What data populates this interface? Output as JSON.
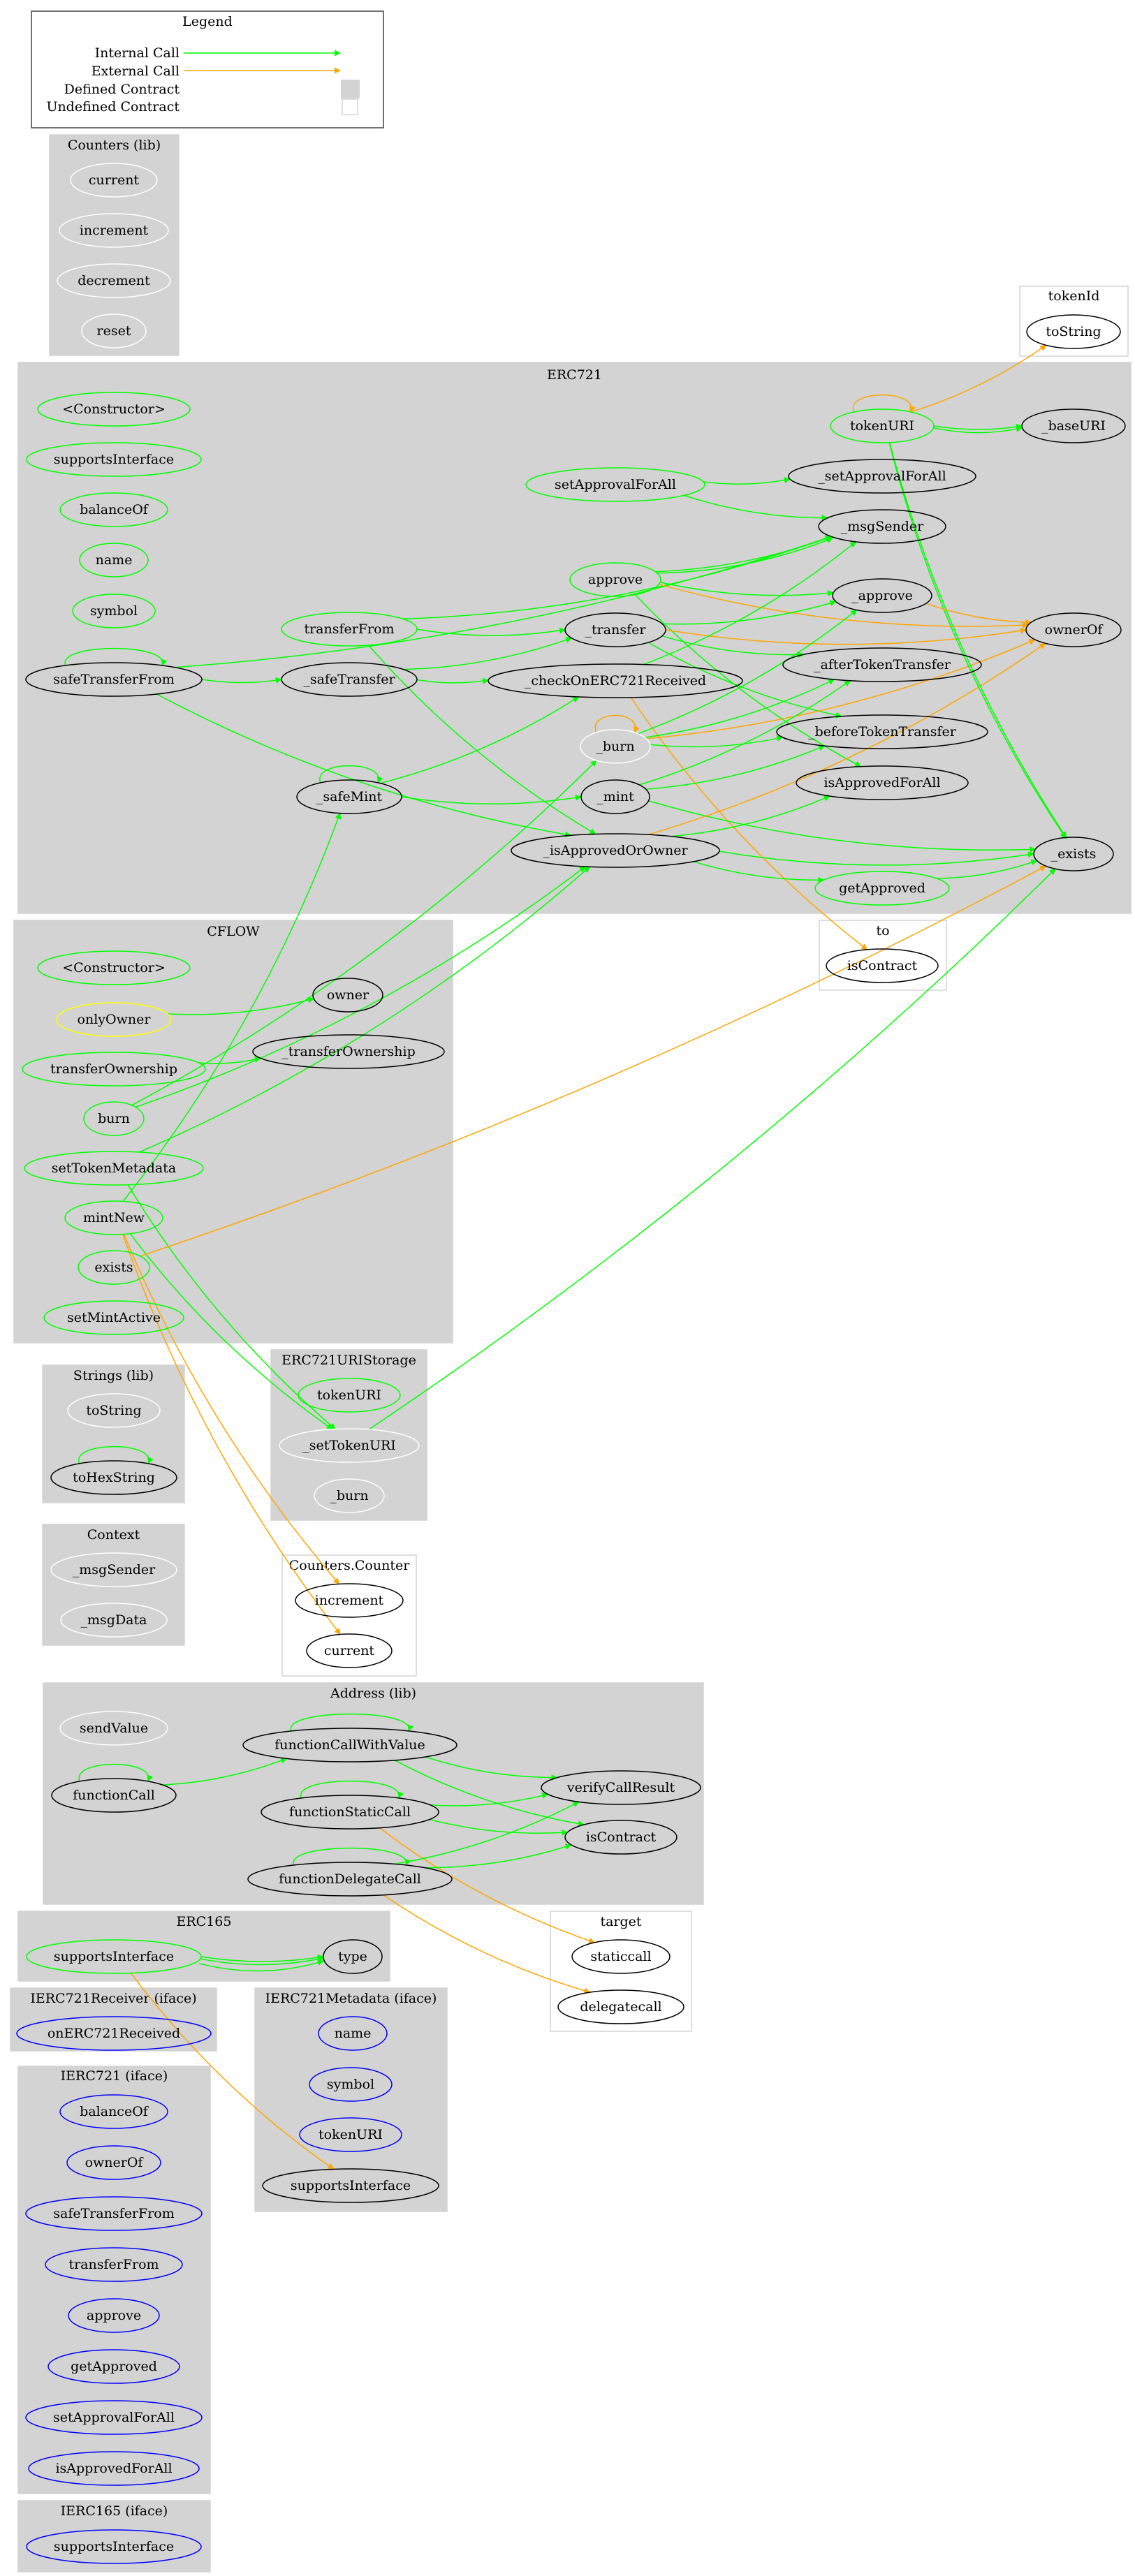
{
  "legend": {
    "title": "Legend",
    "rows": [
      {
        "label": "Internal Call",
        "kind": "internal-arrow"
      },
      {
        "label": "External Call",
        "kind": "external-arrow"
      },
      {
        "label": "Defined Contract",
        "kind": "defined-swatch"
      },
      {
        "label": "Undefined Contract",
        "kind": "undefined-swatch"
      }
    ]
  },
  "colors": {
    "internal_call": "#00ff00",
    "external_call": "#ffa500",
    "defined_cluster_fill": "#d3d3d3",
    "undefined_cluster_border": "#d3d3d3",
    "public_node_border": "#00ff00",
    "modifier_node_border": "#ffff00",
    "interface_node_border": "#0000ff",
    "internal_node_border": "#000000",
    "unused_node_border": "#ffffff"
  },
  "clusters": [
    {
      "id": "counters_lib",
      "title": "Counters  (lib)",
      "defined": true,
      "nodes": [
        {
          "id": "counters_current",
          "label": "current",
          "style": "unused"
        },
        {
          "id": "counters_increment",
          "label": "increment",
          "style": "unused"
        },
        {
          "id": "counters_decrement",
          "label": "decrement",
          "style": "unused"
        },
        {
          "id": "counters_reset",
          "label": "reset",
          "style": "unused"
        }
      ]
    },
    {
      "id": "tokenId",
      "title": "tokenId",
      "defined": false,
      "nodes": [
        {
          "id": "tokenId_toString",
          "label": "toString",
          "style": "internal"
        }
      ]
    },
    {
      "id": "erc721",
      "title": "ERC721",
      "defined": true,
      "nodes": [
        {
          "id": "e_constructor",
          "label": "<Constructor>",
          "style": "public"
        },
        {
          "id": "e_supportsInterface",
          "label": "supportsInterface",
          "style": "public"
        },
        {
          "id": "e_balanceOf",
          "label": "balanceOf",
          "style": "public"
        },
        {
          "id": "e_name",
          "label": "name",
          "style": "public"
        },
        {
          "id": "e_symbol",
          "label": "symbol",
          "style": "public"
        },
        {
          "id": "e_safeTransferFrom",
          "label": "safeTransferFrom",
          "style": "internal"
        },
        {
          "id": "e_transferFrom",
          "label": "transferFrom",
          "style": "public"
        },
        {
          "id": "e__safeTransfer",
          "label": "_safeTransfer",
          "style": "internal"
        },
        {
          "id": "e__safeMint",
          "label": "_safeMint",
          "style": "internal"
        },
        {
          "id": "e_setApprovalForAll",
          "label": "setApprovalForAll",
          "style": "public"
        },
        {
          "id": "e_approve",
          "label": "approve",
          "style": "public"
        },
        {
          "id": "e__transfer",
          "label": "_transfer",
          "style": "internal"
        },
        {
          "id": "e__checkOnERC721Received",
          "label": "_checkOnERC721Received",
          "style": "internal"
        },
        {
          "id": "e__burn",
          "label": "_burn",
          "style": "unused"
        },
        {
          "id": "e__mint",
          "label": "_mint",
          "style": "internal"
        },
        {
          "id": "e__isApprovedOrOwner",
          "label": "_isApprovedOrOwner",
          "style": "internal"
        },
        {
          "id": "e_tokenURI",
          "label": "tokenURI",
          "style": "public"
        },
        {
          "id": "e__setApprovalForAll",
          "label": "_setApprovalForAll",
          "style": "internal"
        },
        {
          "id": "e__msgSender",
          "label": "_msgSender",
          "style": "internal"
        },
        {
          "id": "e__approve",
          "label": "_approve",
          "style": "internal"
        },
        {
          "id": "e__afterTokenTransfer",
          "label": "_afterTokenTransfer",
          "style": "internal"
        },
        {
          "id": "e__beforeTokenTransfer",
          "label": "_beforeTokenTransfer",
          "style": "internal"
        },
        {
          "id": "e_isApprovedForAll",
          "label": "isApprovedForAll",
          "style": "internal"
        },
        {
          "id": "e_getApproved",
          "label": "getApproved",
          "style": "public"
        },
        {
          "id": "e__baseURI",
          "label": "_baseURI",
          "style": "internal"
        },
        {
          "id": "e_ownerOf",
          "label": "ownerOf",
          "style": "internal"
        },
        {
          "id": "e__exists",
          "label": "_exists",
          "style": "internal"
        }
      ]
    },
    {
      "id": "to",
      "title": "to",
      "defined": false,
      "nodes": [
        {
          "id": "to_isContract",
          "label": "isContract",
          "style": "internal"
        }
      ]
    },
    {
      "id": "cflow",
      "title": "CFLOW",
      "defined": true,
      "nodes": [
        {
          "id": "c_constructor",
          "label": "<Constructor>",
          "style": "public"
        },
        {
          "id": "c_onlyOwner",
          "label": "onlyOwner",
          "style": "modifier"
        },
        {
          "id": "c_transferOwnership",
          "label": "transferOwnership",
          "style": "public"
        },
        {
          "id": "c_burn",
          "label": "burn",
          "style": "public"
        },
        {
          "id": "c_setTokenMetadata",
          "label": "setTokenMetadata",
          "style": "public"
        },
        {
          "id": "c_mintNew",
          "label": "mintNew",
          "style": "public"
        },
        {
          "id": "c_exists",
          "label": "exists",
          "style": "public"
        },
        {
          "id": "c_setMintActive",
          "label": "setMintActive",
          "style": "public"
        },
        {
          "id": "c_owner",
          "label": "owner",
          "style": "internal"
        },
        {
          "id": "c__transferOwnership",
          "label": "_transferOwnership",
          "style": "internal"
        }
      ]
    },
    {
      "id": "strings_lib",
      "title": "Strings  (lib)",
      "defined": true,
      "nodes": [
        {
          "id": "s_toString",
          "label": "toString",
          "style": "unused"
        },
        {
          "id": "s_toHexString",
          "label": "toHexString",
          "style": "internal"
        }
      ]
    },
    {
      "id": "erc721uristorage",
      "title": "ERC721URIStorage",
      "defined": true,
      "nodes": [
        {
          "id": "u_tokenURI",
          "label": "tokenURI",
          "style": "public"
        },
        {
          "id": "u__setTokenURI",
          "label": "_setTokenURI",
          "style": "unused"
        },
        {
          "id": "u__burn",
          "label": "_burn",
          "style": "unused"
        }
      ]
    },
    {
      "id": "context",
      "title": "Context",
      "defined": true,
      "nodes": [
        {
          "id": "ctx__msgSender",
          "label": "_msgSender",
          "style": "unused"
        },
        {
          "id": "ctx__msgData",
          "label": "_msgData",
          "style": "unused"
        }
      ]
    },
    {
      "id": "counters_counter",
      "title": "Counters.Counter",
      "defined": false,
      "nodes": [
        {
          "id": "cc_increment",
          "label": "increment",
          "style": "internal"
        },
        {
          "id": "cc_current",
          "label": "current",
          "style": "internal"
        }
      ]
    },
    {
      "id": "address_lib",
      "title": "Address  (lib)",
      "defined": true,
      "nodes": [
        {
          "id": "a_sendValue",
          "label": "sendValue",
          "style": "unused"
        },
        {
          "id": "a_functionCall",
          "label": "functionCall",
          "style": "internal"
        },
        {
          "id": "a_functionCallWithValue",
          "label": "functionCallWithValue",
          "style": "internal"
        },
        {
          "id": "a_functionStaticCall",
          "label": "functionStaticCall",
          "style": "internal"
        },
        {
          "id": "a_functionDelegateCall",
          "label": "functionDelegateCall",
          "style": "internal"
        },
        {
          "id": "a_verifyCallResult",
          "label": "verifyCallResult",
          "style": "internal"
        },
        {
          "id": "a_isContract",
          "label": "isContract",
          "style": "internal"
        }
      ]
    },
    {
      "id": "erc165",
      "title": "ERC165",
      "defined": true,
      "nodes": [
        {
          "id": "r_supportsInterface",
          "label": "supportsInterface",
          "style": "public"
        },
        {
          "id": "r_type",
          "label": "type",
          "style": "internal"
        }
      ]
    },
    {
      "id": "target",
      "title": "target",
      "defined": false,
      "nodes": [
        {
          "id": "t_staticcall",
          "label": "staticcall",
          "style": "internal"
        },
        {
          "id": "t_delegatecall",
          "label": "delegatecall",
          "style": "internal"
        }
      ]
    },
    {
      "id": "ierc721receiver",
      "title": "IERC721Receiver  (iface)",
      "defined": true,
      "nodes": [
        {
          "id": "ir_onERC721Received",
          "label": "onERC721Received",
          "style": "interface"
        }
      ]
    },
    {
      "id": "ierc721metadata",
      "title": "IERC721Metadata  (iface)",
      "defined": true,
      "nodes": [
        {
          "id": "im_name",
          "label": "name",
          "style": "interface"
        },
        {
          "id": "im_symbol",
          "label": "symbol",
          "style": "interface"
        },
        {
          "id": "im_tokenURI",
          "label": "tokenURI",
          "style": "interface"
        },
        {
          "id": "im_supportsInterface",
          "label": "supportsInterface",
          "style": "internal"
        }
      ]
    },
    {
      "id": "ierc721",
      "title": "IERC721  (iface)",
      "defined": true,
      "nodes": [
        {
          "id": "i_balanceOf",
          "label": "balanceOf",
          "style": "interface"
        },
        {
          "id": "i_ownerOf",
          "label": "ownerOf",
          "style": "interface"
        },
        {
          "id": "i_safeTransferFrom",
          "label": "safeTransferFrom",
          "style": "interface"
        },
        {
          "id": "i_transferFrom",
          "label": "transferFrom",
          "style": "interface"
        },
        {
          "id": "i_approve",
          "label": "approve",
          "style": "interface"
        },
        {
          "id": "i_getApproved",
          "label": "getApproved",
          "style": "interface"
        },
        {
          "id": "i_setApprovalForAll",
          "label": "setApprovalForAll",
          "style": "interface"
        },
        {
          "id": "i_isApprovedForAll",
          "label": "isApprovedForAll",
          "style": "interface"
        }
      ]
    },
    {
      "id": "ierc165",
      "title": "IERC165  (iface)",
      "defined": true,
      "nodes": [
        {
          "id": "i165_supportsInterface",
          "label": "supportsInterface",
          "style": "interface"
        }
      ]
    }
  ],
  "edges": [
    {
      "from": "e_safeTransferFrom",
      "to": "e_safeTransferFrom",
      "type": "internal"
    },
    {
      "from": "e_safeTransferFrom",
      "to": "e__safeTransfer",
      "type": "internal"
    },
    {
      "from": "e_safeTransferFrom",
      "to": "e__msgSender",
      "type": "internal"
    },
    {
      "from": "e_safeTransferFrom",
      "to": "e__isApprovedOrOwner",
      "type": "internal"
    },
    {
      "from": "e_transferFrom",
      "to": "e__transfer",
      "type": "internal"
    },
    {
      "from": "e_transferFrom",
      "to": "e__msgSender",
      "type": "internal"
    },
    {
      "from": "e_transferFrom",
      "to": "e__isApprovedOrOwner",
      "type": "internal"
    },
    {
      "from": "e__safeTransfer",
      "to": "e__transfer",
      "type": "internal"
    },
    {
      "from": "e__safeTransfer",
      "to": "e__checkOnERC721Received",
      "type": "internal"
    },
    {
      "from": "e__safeMint",
      "to": "e__safeMint",
      "type": "internal"
    },
    {
      "from": "e__safeMint",
      "to": "e__mint",
      "type": "internal"
    },
    {
      "from": "e__safeMint",
      "to": "e__checkOnERC721Received",
      "type": "internal"
    },
    {
      "from": "e_setApprovalForAll",
      "to": "e__setApprovalForAll",
      "type": "internal"
    },
    {
      "from": "e_setApprovalForAll",
      "to": "e__msgSender",
      "type": "internal"
    },
    {
      "from": "e_approve",
      "to": "e__msgSender",
      "type": "internal"
    },
    {
      "from": "e_approve",
      "to": "e__msgSender",
      "type": "internal"
    },
    {
      "from": "e_approve",
      "to": "e__approve",
      "type": "internal"
    },
    {
      "from": "e_approve",
      "to": "e_ownerOf",
      "type": "external"
    },
    {
      "from": "e_approve",
      "to": "e_isApprovedForAll",
      "type": "internal"
    },
    {
      "from": "e__transfer",
      "to": "e__approve",
      "type": "internal"
    },
    {
      "from": "e__transfer",
      "to": "e_ownerOf",
      "type": "external"
    },
    {
      "from": "e__transfer",
      "to": "e__afterTokenTransfer",
      "type": "internal"
    },
    {
      "from": "e__transfer",
      "to": "e__beforeTokenTransfer",
      "type": "internal"
    },
    {
      "from": "e__checkOnERC721Received",
      "to": "e__msgSender",
      "type": "internal"
    },
    {
      "from": "e__checkOnERC721Received",
      "to": "to_isContract",
      "type": "external"
    },
    {
      "from": "e__burn",
      "to": "e__burn",
      "type": "external"
    },
    {
      "from": "e__burn",
      "to": "e__approve",
      "type": "internal"
    },
    {
      "from": "e__burn",
      "to": "e__afterTokenTransfer",
      "type": "internal"
    },
    {
      "from": "e__burn",
      "to": "e__beforeTokenTransfer",
      "type": "internal"
    },
    {
      "from": "e__burn",
      "to": "e_ownerOf",
      "type": "external"
    },
    {
      "from": "e__mint",
      "to": "e__afterTokenTransfer",
      "type": "internal"
    },
    {
      "from": "e__mint",
      "to": "e__beforeTokenTransfer",
      "type": "internal"
    },
    {
      "from": "e__mint",
      "to": "e__exists",
      "type": "internal"
    },
    {
      "from": "e__isApprovedOrOwner",
      "to": "e__exists",
      "type": "internal"
    },
    {
      "from": "e__isApprovedOrOwner",
      "to": "e_isApprovedForAll",
      "type": "internal"
    },
    {
      "from": "e__isApprovedOrOwner",
      "to": "e_getApproved",
      "type": "internal"
    },
    {
      "from": "e__isApprovedOrOwner",
      "to": "e_ownerOf",
      "type": "external"
    },
    {
      "from": "e_tokenURI",
      "to": "e_tokenURI",
      "type": "external"
    },
    {
      "from": "e_tokenURI",
      "to": "tokenId_toString",
      "type": "external"
    },
    {
      "from": "e_tokenURI",
      "to": "e__baseURI",
      "type": "internal"
    },
    {
      "from": "e_tokenURI",
      "to": "e__baseURI",
      "type": "internal"
    },
    {
      "from": "e_tokenURI",
      "to": "e__exists",
      "type": "internal"
    },
    {
      "from": "e_tokenURI",
      "to": "e__exists",
      "type": "internal"
    },
    {
      "from": "e__approve",
      "to": "e_ownerOf",
      "type": "external"
    },
    {
      "from": "e_getApproved",
      "to": "e__exists",
      "type": "internal"
    },
    {
      "from": "c_onlyOwner",
      "to": "c_owner",
      "type": "internal"
    },
    {
      "from": "c_transferOwnership",
      "to": "c__transferOwnership",
      "type": "internal"
    },
    {
      "from": "c_burn",
      "to": "e__burn",
      "type": "internal"
    },
    {
      "from": "c_burn",
      "to": "e__isApprovedOrOwner",
      "type": "internal"
    },
    {
      "from": "c_setTokenMetadata",
      "to": "e__isApprovedOrOwner",
      "type": "internal"
    },
    {
      "from": "c_setTokenMetadata",
      "to": "u__setTokenURI",
      "type": "internal"
    },
    {
      "from": "c_mintNew",
      "to": "e__safeMint",
      "type": "internal"
    },
    {
      "from": "c_mintNew",
      "to": "u__setTokenURI",
      "type": "internal"
    },
    {
      "from": "c_mintNew",
      "to": "cc_increment",
      "type": "external"
    },
    {
      "from": "c_mintNew",
      "to": "cc_current",
      "type": "external"
    },
    {
      "from": "c_exists",
      "to": "e__exists",
      "type": "external"
    },
    {
      "from": "u__setTokenURI",
      "to": "e__exists",
      "type": "internal"
    },
    {
      "from": "s_toHexString",
      "to": "s_toHexString",
      "type": "internal"
    },
    {
      "from": "a_functionCall",
      "to": "a_functionCall",
      "type": "internal"
    },
    {
      "from": "a_functionCall",
      "to": "a_functionCallWithValue",
      "type": "internal"
    },
    {
      "from": "a_functionCallWithValue",
      "to": "a_functionCallWithValue",
      "type": "internal"
    },
    {
      "from": "a_functionCallWithValue",
      "to": "a_verifyCallResult",
      "type": "internal"
    },
    {
      "from": "a_functionCallWithValue",
      "to": "a_isContract",
      "type": "internal"
    },
    {
      "from": "a_functionStaticCall",
      "to": "a_functionStaticCall",
      "type": "internal"
    },
    {
      "from": "a_functionStaticCall",
      "to": "a_verifyCallResult",
      "type": "internal"
    },
    {
      "from": "a_functionStaticCall",
      "to": "a_isContract",
      "type": "internal"
    },
    {
      "from": "a_functionStaticCall",
      "to": "t_staticcall",
      "type": "external"
    },
    {
      "from": "a_functionDelegateCall",
      "to": "a_functionDelegateCall",
      "type": "internal"
    },
    {
      "from": "a_functionDelegateCall",
      "to": "a_verifyCallResult",
      "type": "internal"
    },
    {
      "from": "a_functionDelegateCall",
      "to": "a_isContract",
      "type": "internal"
    },
    {
      "from": "a_functionDelegateCall",
      "to": "t_delegatecall",
      "type": "external"
    },
    {
      "from": "r_supportsInterface",
      "to": "r_type",
      "type": "internal"
    },
    {
      "from": "r_supportsInterface",
      "to": "r_type",
      "type": "internal"
    },
    {
      "from": "r_supportsInterface",
      "to": "r_type",
      "type": "internal"
    },
    {
      "from": "r_supportsInterface",
      "to": "im_supportsInterface",
      "type": "external"
    }
  ]
}
